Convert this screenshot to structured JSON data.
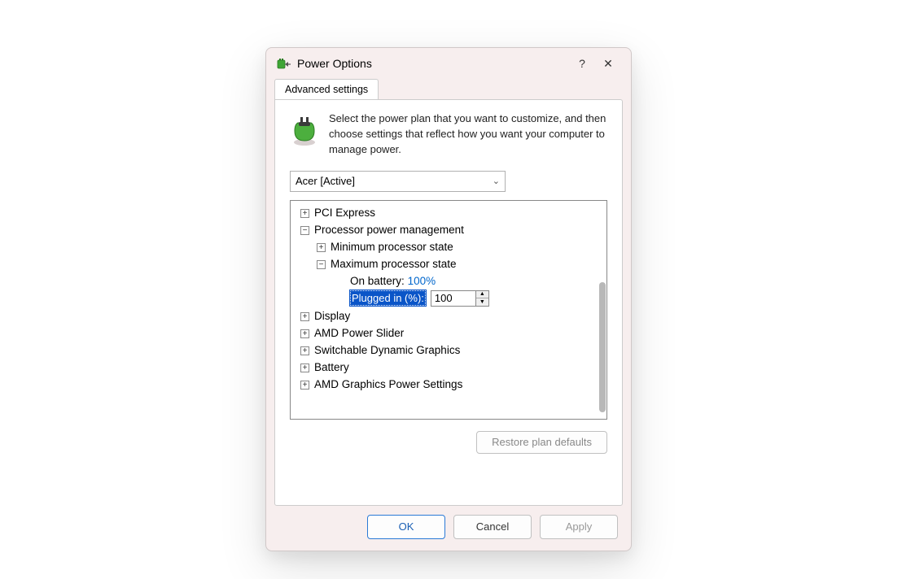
{
  "titlebar": {
    "title": "Power Options",
    "help": "?",
    "close": "✕"
  },
  "tabs": {
    "advanced": "Advanced settings"
  },
  "description": "Select the power plan that you want to customize, and then choose settings that reflect how you want your computer to manage power.",
  "combo": {
    "selected": "Acer [Active]"
  },
  "tree": {
    "pci_express": "PCI Express",
    "processor_pm": "Processor power management",
    "min_ps": "Minimum processor state",
    "max_ps": "Maximum processor state",
    "on_battery_label": "On battery:",
    "on_battery_value": "100%",
    "plugged_in_label": "Plugged in (%):",
    "plugged_in_value": "100",
    "display": "Display",
    "amd_slider": "AMD Power Slider",
    "switchable": "Switchable Dynamic Graphics",
    "battery": "Battery",
    "amd_graphics": "AMD Graphics Power Settings"
  },
  "buttons": {
    "restore": "Restore plan defaults",
    "ok": "OK",
    "cancel": "Cancel",
    "apply": "Apply"
  }
}
